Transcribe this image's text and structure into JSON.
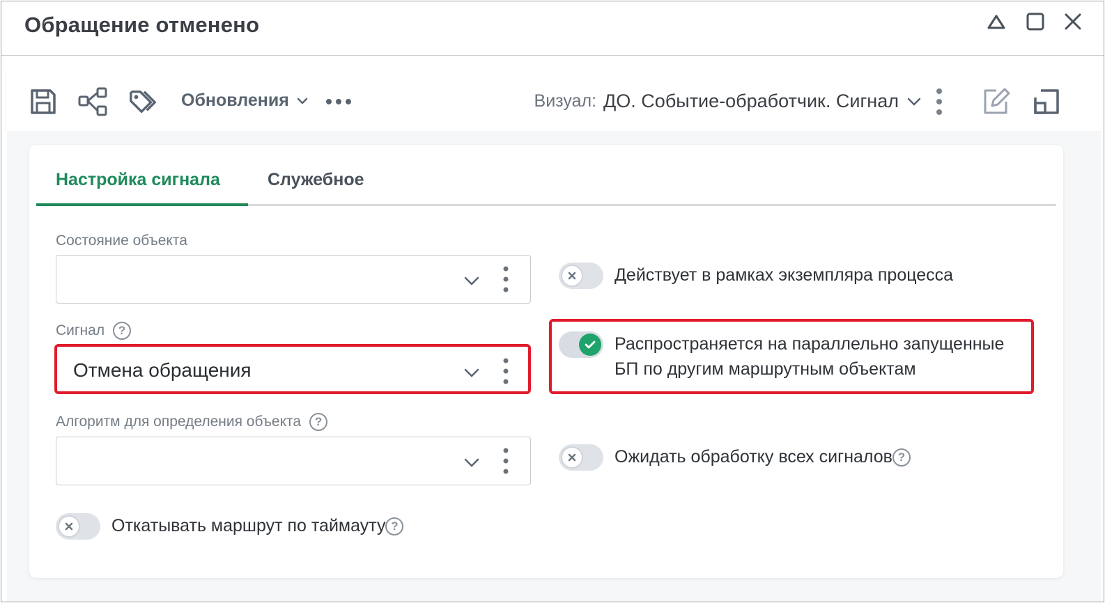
{
  "window": {
    "title": "Обращение отменено"
  },
  "toolbar": {
    "updates_label": "Обновления",
    "visual_label": "Визуал:",
    "visual_value": "ДО. Событие-обработчик. Сигнал"
  },
  "tabs": [
    {
      "label": "Настройка сигнала",
      "active": true
    },
    {
      "label": "Служебное",
      "active": false
    }
  ],
  "form": {
    "object_state": {
      "label": "Состояние объекта",
      "value": ""
    },
    "signal": {
      "label": "Сигнал",
      "value": "Отмена обращения"
    },
    "algorithm": {
      "label": "Алгоритм для определения объекта",
      "value": ""
    },
    "toggles": {
      "rollback": {
        "label": "Откатывать маршрут по таймауту",
        "on": false
      },
      "instance_scope": {
        "label": "Действует в рамках экземпляра процесса",
        "on": false
      },
      "parallel": {
        "label": "Распространяется на параллельно запущенные БП по другим маршрутным объектам",
        "on": true
      },
      "wait_all": {
        "label": "Ожидать обработку всех сигналов",
        "on": false
      }
    }
  },
  "help_glyph": "?",
  "colors": {
    "accent": "#1e8a5a",
    "toggle_on": "#1ea36b",
    "highlight": "#e11b2b"
  }
}
